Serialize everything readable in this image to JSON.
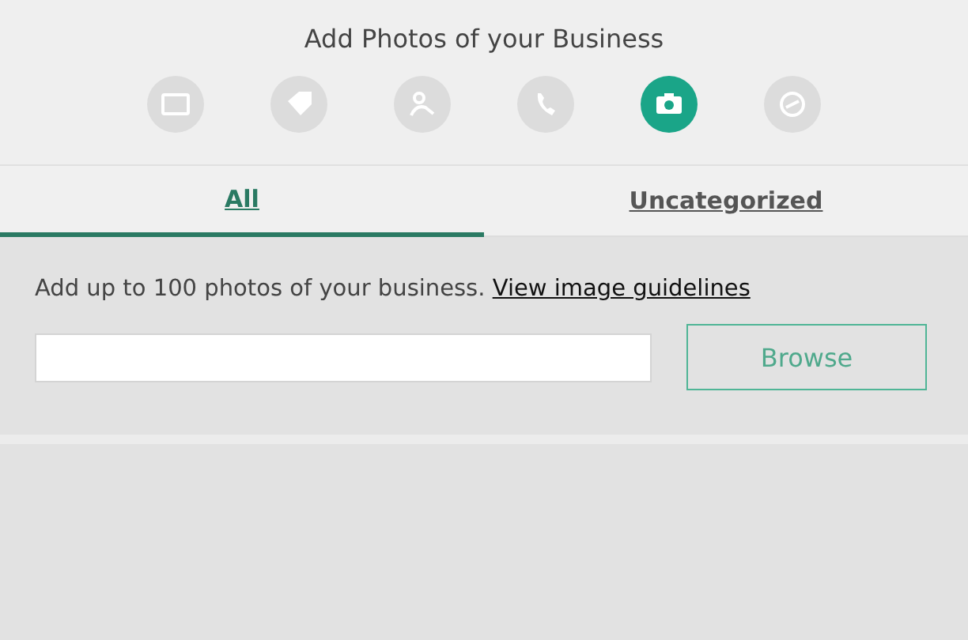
{
  "header": {
    "title": "Add Photos of your Business"
  },
  "steps": [
    {
      "kind": "card",
      "selected": false
    },
    {
      "kind": "tag",
      "selected": false
    },
    {
      "kind": "people",
      "selected": false
    },
    {
      "kind": "phone",
      "selected": false
    },
    {
      "kind": "camera",
      "selected": true
    },
    {
      "kind": "clock",
      "selected": false
    }
  ],
  "tabs": [
    {
      "label": "All",
      "selected": true
    },
    {
      "label": "Uncategorized",
      "selected": false
    }
  ],
  "upload": {
    "text": "Add up to 100 photos of your business.",
    "link": "View image guidelines",
    "button": "Browse"
  }
}
